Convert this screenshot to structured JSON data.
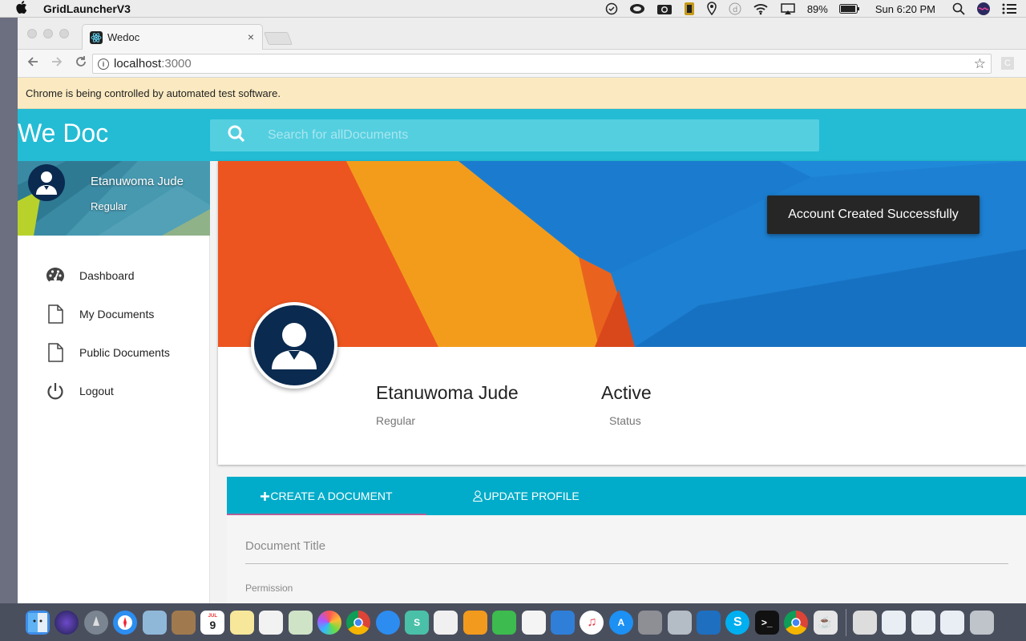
{
  "menubar": {
    "app_name": "GridLauncherV3",
    "battery": "89%",
    "clock": "Sun 6:20 PM"
  },
  "browser": {
    "tab_title": "Wedoc",
    "tab_close": "×",
    "url_host": "localhost",
    "url_port": ":3000",
    "extension_letter": "C",
    "infobar": "Chrome is being controlled by automated test software."
  },
  "header": {
    "brand": "We Doc",
    "search_placeholder": "Search for allDocuments"
  },
  "sidebar": {
    "user_name": "Etanuwoma Jude",
    "user_role": "Regular",
    "items": [
      {
        "label": "Dashboard",
        "icon": "palette-icon"
      },
      {
        "label": "My Documents",
        "icon": "document-icon"
      },
      {
        "label": "Public Documents",
        "icon": "document-icon"
      },
      {
        "label": "Logout",
        "icon": "power-icon"
      }
    ]
  },
  "profile": {
    "name": "Etanuwoma Jude",
    "role": "Regular",
    "status_value": "Active",
    "status_label": "Status"
  },
  "toast": "Account Created Successfully",
  "tabs": [
    {
      "label": "CREATE A DOCUMENT",
      "icon": "plus-icon",
      "active": true
    },
    {
      "label": "UPDATE PROFILE",
      "icon": "user-outline-icon",
      "active": false
    }
  ],
  "form": {
    "title_label": "Document Title",
    "permission_label": "Permission"
  },
  "dock": {
    "calendar_month": "JUL",
    "calendar_day": "9"
  },
  "colors": {
    "header": "#23bcd4",
    "tabs": "#00acc9",
    "avatar": "#0a2a4f",
    "toast": "#262626"
  }
}
